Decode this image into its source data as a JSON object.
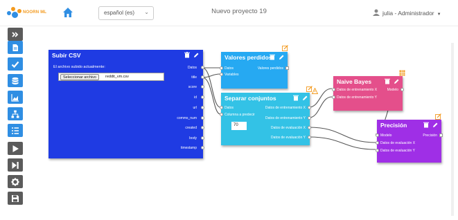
{
  "header": {
    "logo_text": "NOORN ML",
    "language": "español (es)",
    "project_title": "Nuevo proyecto 19",
    "user": "julia - Administrador"
  },
  "colors": {
    "sidebar": "#2f8ee3",
    "sidebar_dark": "#5b5b5b",
    "subir": "#1f3be3",
    "valores": "#26a9f2",
    "separar": "#33c2e6",
    "naive": "#e44f8b",
    "precision": "#9f2fe6"
  },
  "sidebar": [
    {
      "icon": "collapse-icon"
    },
    {
      "icon": "document-icon"
    },
    {
      "icon": "check-icon"
    },
    {
      "icon": "database-icon"
    },
    {
      "icon": "chart-icon"
    },
    {
      "icon": "hierarchy-icon"
    },
    {
      "icon": "list-icon"
    },
    {
      "icon": "play-icon"
    },
    {
      "icon": "step-icon"
    },
    {
      "icon": "settings-icon"
    },
    {
      "icon": "save-icon"
    }
  ],
  "nodes": {
    "subir_csv": {
      "title": "Subir CSV",
      "status_label": "El archivo subido actualmente:",
      "file_button": "Seleccionar archivo",
      "file_name": "reddit_vm.csv",
      "outputs": [
        "Datos",
        "title",
        "score",
        "id",
        "url",
        "comms_num",
        "created",
        "body",
        "timestamp"
      ]
    },
    "valores_perdidos": {
      "title": "Valores perdidos",
      "inputs": [
        "Datos",
        "Variables"
      ],
      "outputs": [
        "Valores perdidos"
      ]
    },
    "separar": {
      "title": "Separar conjuntos",
      "inputs": [
        "Datos",
        "Columna a predecir"
      ],
      "value": "70",
      "outputs": [
        "Datos de entrenamiento X",
        "Datos de entrenamiento Y",
        "Datos de evaluación X",
        "Datos de evaluación Y"
      ]
    },
    "naive": {
      "title": "Naive Bayes",
      "inputs": [
        "Datos de entrenamiento X",
        "Datos de entrenamiento Y"
      ],
      "outputs": [
        "Modelo"
      ]
    },
    "precision": {
      "title": "Precisión",
      "inputs": [
        "Modelo",
        "Datos de evaluación X",
        "Datos de evaluación Y"
      ],
      "outputs": [
        "Precisión"
      ]
    }
  }
}
